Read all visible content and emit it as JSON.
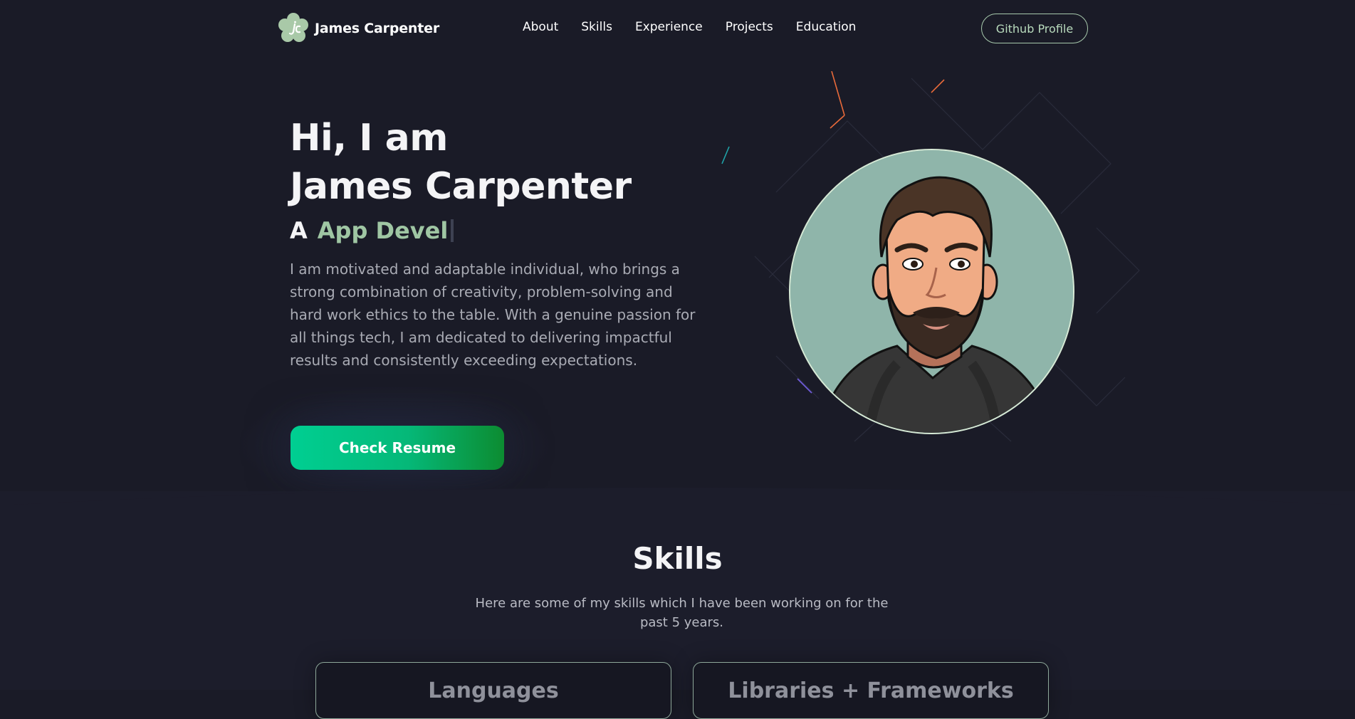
{
  "nav": {
    "brand_name": "James Carpenter",
    "links": [
      "About",
      "Skills",
      "Experience",
      "Projects",
      "Education"
    ],
    "github_label": "Github Profile"
  },
  "hero": {
    "greeting": "Hi, I am",
    "name": "James Carpenter",
    "role_prefix": "A",
    "role_typed": "App Devel",
    "description": "I am motivated and adaptable individual, who brings a strong combination of creativity, problem-solving and hard work ethics to the table. With a genuine passion for all things tech, I am dedicated to delivering impactful results and consistently exceeding expectations.",
    "resume_label": "Check Resume"
  },
  "skills": {
    "title": "Skills",
    "subtitle": "Here are some of my skills which I have been working on for the past 5 years.",
    "cards": [
      "Languages",
      "Libraries + Frameworks"
    ]
  },
  "icons": {
    "brand": "jc-logo-icon",
    "avatar": "profile-avatar"
  },
  "colors": {
    "background": "#1a1b27",
    "accent": "#9fc6a3",
    "button_start": "#00cf92",
    "button_end": "#0c8c31"
  }
}
